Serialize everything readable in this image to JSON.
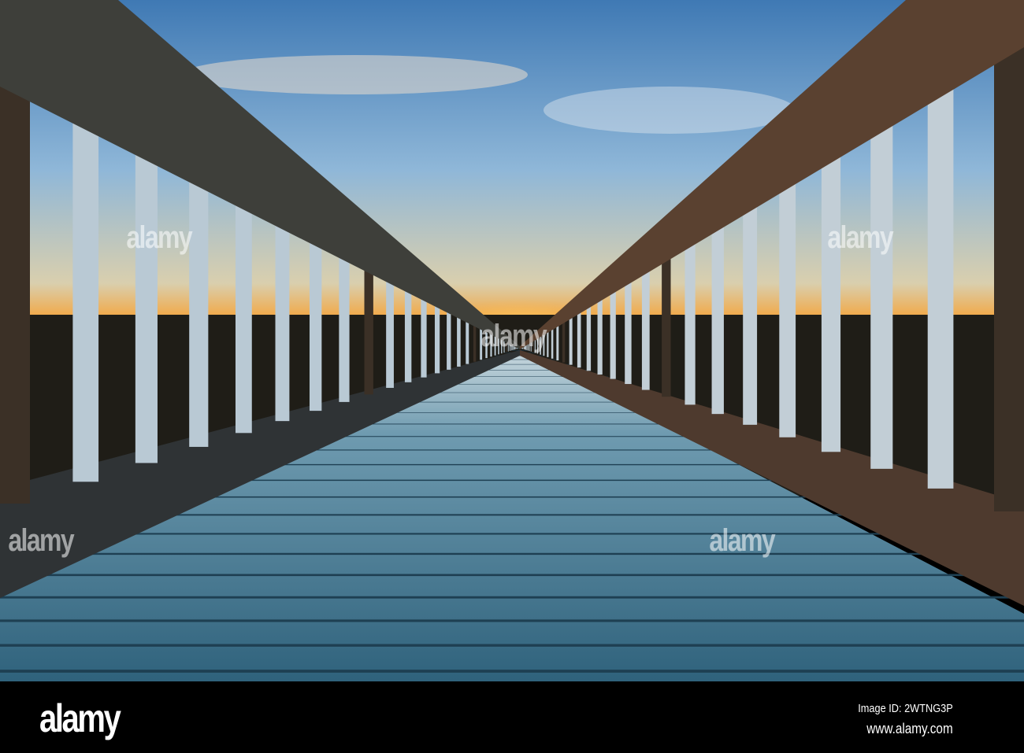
{
  "photo": {
    "subject": "Wooden boardwalk with railings leading to a sunset horizon"
  },
  "watermark": {
    "text": "alamy"
  },
  "footer": {
    "logo": "alamy",
    "image_id": "Image ID: 2WTNG3P",
    "website": "www.alamy.com"
  },
  "colors": {
    "sky_top": "#3f79b4",
    "sky_mid": "#8fb7d8",
    "horizon": "#f5a43a",
    "deck": "#4d7e96",
    "rail": "#4a3a2c",
    "baluster": "#b9c9d4"
  }
}
